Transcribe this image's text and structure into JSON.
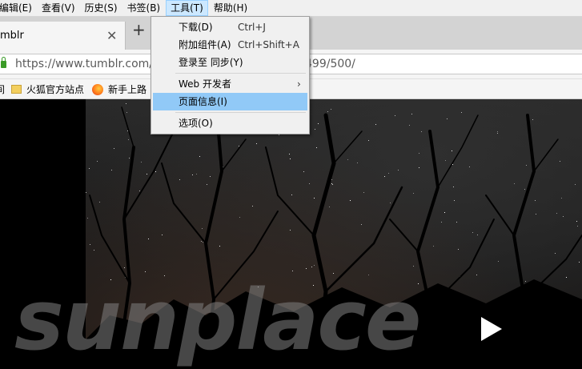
{
  "menubar": {
    "items": [
      "编辑(E)",
      "查看(V)",
      "历史(S)",
      "书签(B)",
      "工具(T)",
      "帮助(H)"
    ],
    "active_index": 4
  },
  "tab": {
    "title": "mblr"
  },
  "address_bar": {
    "url_left": "https://www.tumblr.com/",
    "url_right": "499/500/"
  },
  "bookmarks": {
    "items": [
      {
        "label": "火狐官方站点",
        "icon": "folder-icon"
      },
      {
        "label": "新手上路",
        "icon": "firefox-icon"
      }
    ]
  },
  "tools_menu": {
    "items": [
      {
        "label": "下载(D)",
        "shortcut": "Ctrl+J"
      },
      {
        "label": "附加组件(A)",
        "shortcut": "Ctrl+Shift+A"
      },
      {
        "label": "登录至 同步(Y)",
        "shortcut": ""
      },
      {
        "label": "Web 开发者",
        "shortcut": "",
        "submenu": true
      },
      {
        "label": "页面信息(I)",
        "shortcut": "",
        "highlighted": true
      },
      {
        "label": "选项(O)",
        "shortcut": ""
      }
    ]
  },
  "content": {
    "watermark": "sunplace",
    "play_icon": "play-icon"
  },
  "colors": {
    "menu_highlight": "#91c9f7",
    "active_menubar": "#cce8ff",
    "secure_lock": "#3a9b27"
  }
}
